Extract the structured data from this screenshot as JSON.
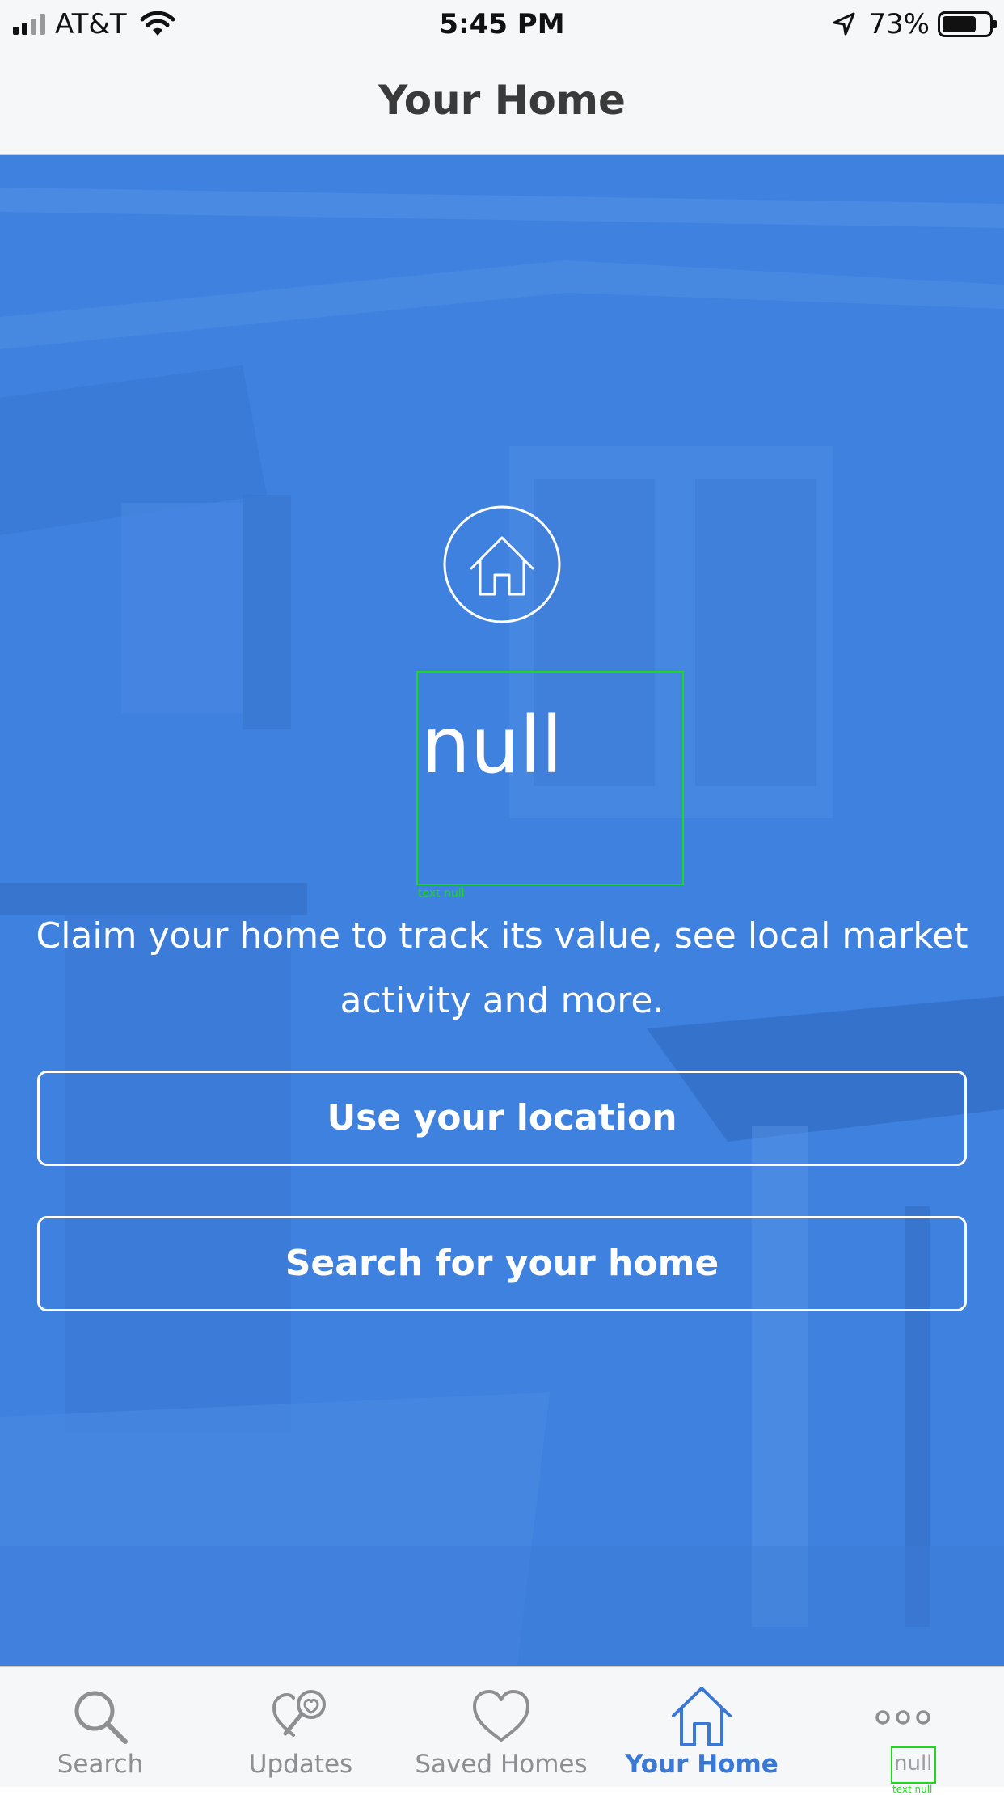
{
  "status_bar": {
    "carrier": "AT&T",
    "time": "5:45 PM",
    "battery_percent": "73%",
    "battery_level": 0.73,
    "icons": [
      "signal-bars-icon",
      "wifi-icon",
      "location-arrow-icon",
      "battery-icon"
    ]
  },
  "header": {
    "title": "Your Home"
  },
  "hero": {
    "icon": "house-icon",
    "address_value": "null",
    "debug_label": "text null",
    "message": "Claim your home to track its value, see local market activity and more.",
    "buttons": {
      "use_location": "Use your location",
      "search_home": "Search for your home"
    },
    "overlay_color": "#3f81de"
  },
  "tab_bar": {
    "tabs": [
      {
        "label": "Search",
        "icon": "search-icon",
        "active": false
      },
      {
        "label": "Updates",
        "icon": "updates-heart-search-icon",
        "active": false
      },
      {
        "label": "Saved Homes",
        "icon": "heart-icon",
        "active": false
      },
      {
        "label": "Your Home",
        "icon": "house-icon",
        "active": true
      },
      {
        "label": "null",
        "icon": "more-dots-icon",
        "active": false,
        "debug_label": "text null"
      }
    ],
    "active_color": "#3a78d6",
    "inactive_color": "#8e8e93"
  }
}
